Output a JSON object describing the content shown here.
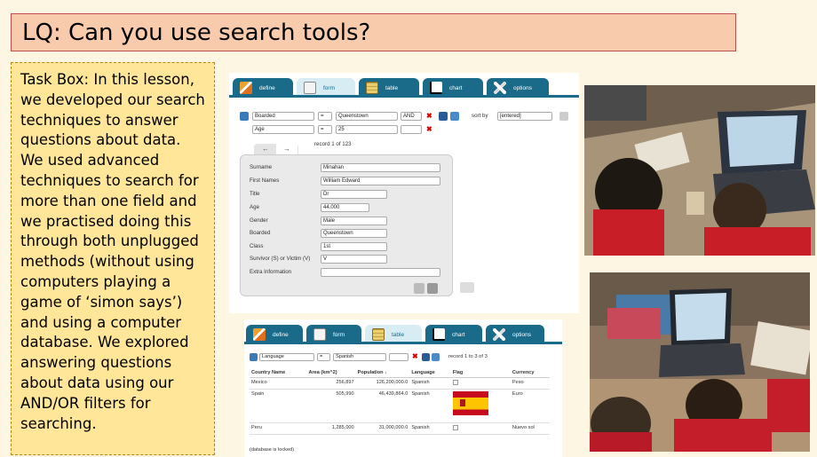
{
  "title": "LQ: Can you use search tools?",
  "task_box": "Task Box: In this lesson, we developed our search techniques to answer questions about data. We used advanced techniques to search for more than one field and we practised doing this through both unplugged methods (without using computers playing a game of ‘simon says’) and using a computer database. We explored answering questions about data using our AND/OR filters for searching.",
  "tabs": [
    "define",
    "form",
    "table",
    "chart",
    "options"
  ],
  "form_search": {
    "row1": {
      "field": "Boarded",
      "op": "=",
      "value": "Queenstown",
      "logic": "AND"
    },
    "row2": {
      "field": "Age",
      "op": "=",
      "value": "25"
    },
    "sort_label": "sort by",
    "sort_value": "[entered]",
    "record_text": "record 1 of 123",
    "prev_arrow": "←",
    "next_arrow": "→"
  },
  "form_fields": [
    {
      "label": "Surname",
      "value": "Minahan"
    },
    {
      "label": "First Names",
      "value": "William Edward"
    },
    {
      "label": "Title",
      "value": "Dr"
    },
    {
      "label": "Age",
      "value": "44.000"
    },
    {
      "label": "Gender",
      "value": "Male"
    },
    {
      "label": "Boarded",
      "value": "Queenstown"
    },
    {
      "label": "Class",
      "value": "1st"
    },
    {
      "label": "Survivor (S) or Victim (V)",
      "value": "V"
    },
    {
      "label": "Extra Information",
      "value": ""
    }
  ],
  "table_search": {
    "field": "Language",
    "op": "=",
    "value": "Spanish",
    "record_text": "record 1 to 3 of 3"
  },
  "table": {
    "headers": [
      "Country Name",
      "Area (km^2)",
      "Population ↓",
      "Language",
      "Flag",
      "Currency"
    ],
    "rows": [
      {
        "country": "Mexico",
        "area": "256,897",
        "population": "126,200,000.0",
        "language": "Spanish",
        "currency": "Peso"
      },
      {
        "country": "Spain",
        "area": "505,990",
        "population": "46,439,864.0",
        "language": "Spanish",
        "currency": "Euro"
      },
      {
        "country": "Peru",
        "area": "1,285,000",
        "population": "31,000,000.0",
        "language": "Spanish",
        "currency": "Nuevo sol"
      }
    ],
    "footer": "(database is locked)"
  },
  "colors": {
    "tab": "#1a6b8a",
    "title_bg": "#f8cbad",
    "task_bg": "#ffe699"
  }
}
